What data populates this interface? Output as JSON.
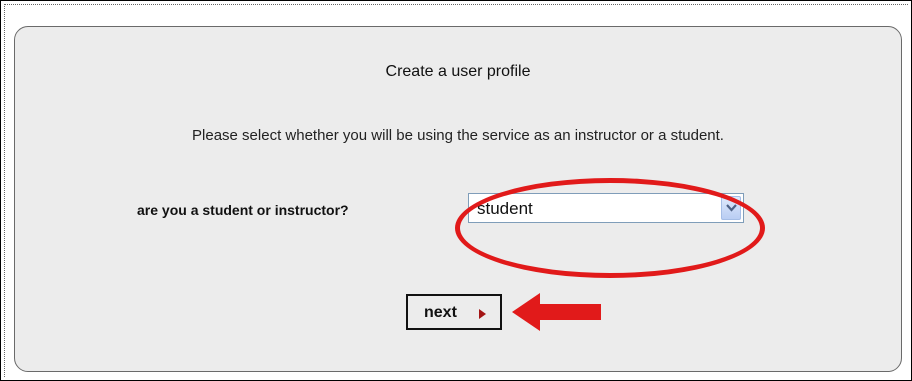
{
  "form": {
    "title": "Create a user profile",
    "instructions": "Please select whether you will be using the service as an instructor or a student.",
    "question_label": "are you a student or instructor?",
    "role_select": {
      "selected_value": "student"
    },
    "next_label": "next"
  },
  "annotations": {
    "highlight_color": "#e11a1a",
    "icons": [
      "chevron-down-icon",
      "caret-right-icon",
      "red-left-arrow-icon"
    ]
  }
}
